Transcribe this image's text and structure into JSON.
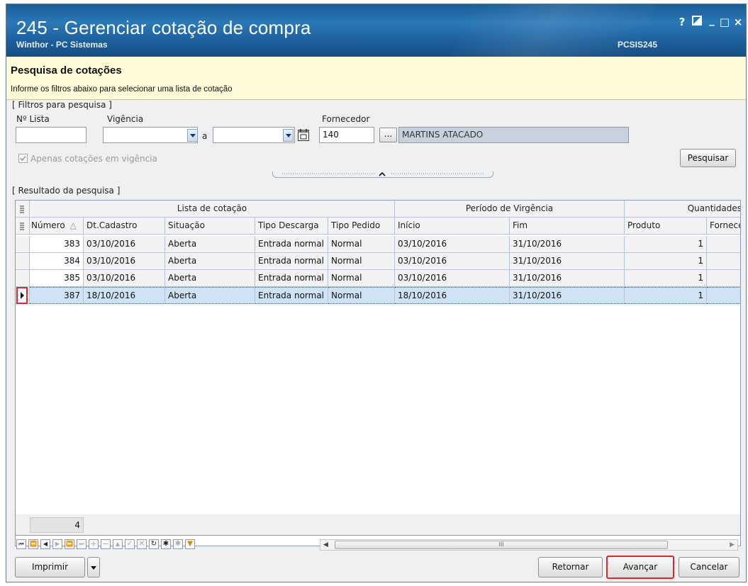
{
  "window": {
    "title": "245 - Gerenciar cotação de compra",
    "subtitle": "Winthor - PC Sistemas",
    "code": "PCSIS245",
    "help": "?",
    "minimize": "_",
    "maximize": "□",
    "close": "×"
  },
  "header": {
    "title": "Pesquisa de cotações",
    "instruction": "Informe os filtros abaixo para selecionar uma lista de cotação"
  },
  "filters": {
    "group_label": "[ Filtros para pesquisa ]",
    "num_lista_label": "Nº Lista",
    "num_lista_value": "",
    "vigencia_label": "Vigência",
    "vigencia_from": "",
    "a_label": "a",
    "vigencia_to": "",
    "fornecedor_label": "Fornecedor",
    "fornecedor_code": "140",
    "fornecedor_lookup": "...",
    "fornecedor_name": "MARTINS ATACADO",
    "apenas_label": "Apenas cotações em vigência",
    "apenas_checked": true,
    "search_button": "Pesquisar"
  },
  "results": {
    "group_label": "[ Resultado da pesquisa ]",
    "band_headers": [
      "Lista de cotação",
      "Período de Virgência",
      "Quantidades"
    ],
    "columns": [
      "Número",
      "Dt.Cadastro",
      "Situação",
      "Tipo Descarga",
      "Tipo Pedido",
      "Início",
      "Fim",
      "Produto",
      "Fornecedor"
    ],
    "rows": [
      [
        "383",
        "03/10/2016",
        "Aberta",
        "Entrada normal",
        "Normal",
        "03/10/2016",
        "31/10/2016",
        "1",
        ""
      ],
      [
        "384",
        "03/10/2016",
        "Aberta",
        "Entrada normal",
        "Normal",
        "03/10/2016",
        "31/10/2016",
        "1",
        ""
      ],
      [
        "385",
        "03/10/2016",
        "Aberta",
        "Entrada normal",
        "Normal",
        "03/10/2016",
        "31/10/2016",
        "1",
        ""
      ],
      [
        "387",
        "18/10/2016",
        "Aberta",
        "Entrada normal",
        "Normal",
        "18/10/2016",
        "31/10/2016",
        "1",
        ""
      ]
    ],
    "selected_row": 3,
    "record_count": "4"
  },
  "hscroll": {
    "label": "III"
  },
  "footer": {
    "print_button": "Imprimir",
    "back_button": "Retornar",
    "next_button": "Avançar",
    "cancel_button": "Cancelar"
  },
  "colors": {
    "titlebar": "#1c5f9c",
    "header_bg": "#fdfbd8",
    "selected_row": "#cfe3f7",
    "highlight": "#e0252b"
  }
}
